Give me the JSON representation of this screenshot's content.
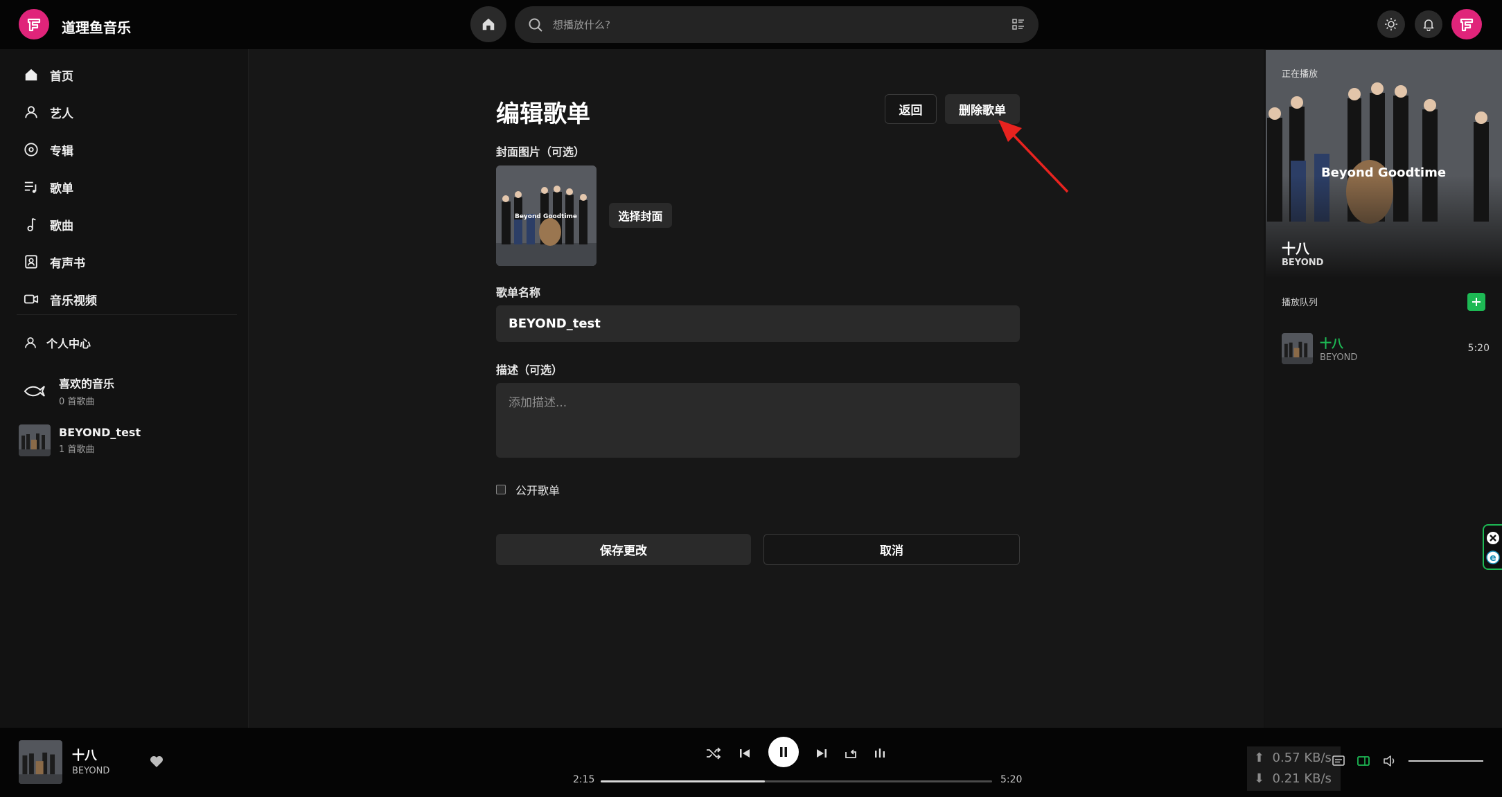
{
  "app": {
    "title": "道理鱼音乐"
  },
  "search": {
    "placeholder": "想播放什么?"
  },
  "sidebar": {
    "items": [
      {
        "label": "首页"
      },
      {
        "label": "艺人"
      },
      {
        "label": "专辑"
      },
      {
        "label": "歌单"
      },
      {
        "label": "歌曲"
      },
      {
        "label": "有声书"
      },
      {
        "label": "音乐视频"
      }
    ],
    "profile": {
      "label": "个人中心"
    },
    "playlists": [
      {
        "title": "喜欢的音乐",
        "subtitle": "0 首歌曲"
      },
      {
        "title": "BEYOND_test",
        "subtitle": "1 首歌曲"
      }
    ]
  },
  "editor": {
    "title": "编辑歌单",
    "back_label": "返回",
    "delete_label": "删除歌单",
    "cover_label": "封面图片（可选）",
    "cover_text": "Beyond Goodtime",
    "choose_cover_label": "选择封面",
    "name_label": "歌单名称",
    "name_value": "BEYOND_test",
    "desc_label": "描述（可选）",
    "desc_placeholder": "添加描述...",
    "public_label": "公开歌单",
    "public_checked": false,
    "save_label": "保存更改",
    "cancel_label": "取消"
  },
  "now_playing_panel": {
    "header": "正在播放",
    "art_text": "Beyond Goodtime",
    "track_title": "十八",
    "track_artist": "BEYOND",
    "queue_label": "播放队列",
    "queue": [
      {
        "title": "十八",
        "artist": "BEYOND",
        "duration": "5:20"
      }
    ]
  },
  "player": {
    "track_title": "十八",
    "track_artist": "BEYOND",
    "current_time": "2:15",
    "total_time": "5:20",
    "progress": 0.42,
    "upload_speed": "0.57 KB/s",
    "download_speed": "0.21 KB/s",
    "volume": 1.0
  },
  "colors": {
    "accent": "#e0247a",
    "green": "#1db954",
    "annotation_arrow": "#e8231f"
  }
}
